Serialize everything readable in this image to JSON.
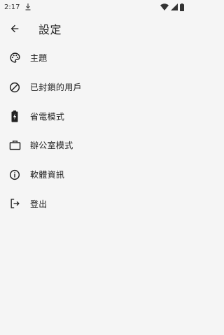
{
  "status_bar": {
    "time": "2:17"
  },
  "header": {
    "title": "設定"
  },
  "menu": {
    "items": [
      {
        "label": "主題",
        "icon": "palette-icon"
      },
      {
        "label": "已封鎖的用戶",
        "icon": "block-icon"
      },
      {
        "label": "省電模式",
        "icon": "battery-saver-icon"
      },
      {
        "label": "辦公室模式",
        "icon": "briefcase-icon"
      },
      {
        "label": "軟體資訊",
        "icon": "info-icon"
      },
      {
        "label": "登出",
        "icon": "logout-icon"
      }
    ]
  }
}
